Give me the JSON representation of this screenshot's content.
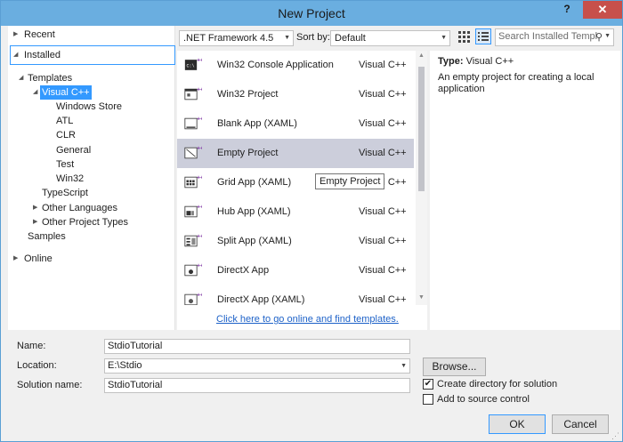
{
  "window": {
    "title": "New Project",
    "help_label": "?",
    "close_label": "✕"
  },
  "left_nav": {
    "recent": "Recent",
    "installed": "Installed",
    "templates": "Templates",
    "visual_cpp": "Visual C++",
    "vc_children": [
      "Windows Store",
      "ATL",
      "CLR",
      "General",
      "Test",
      "Win32"
    ],
    "typescript": "TypeScript",
    "other_languages": "Other Languages",
    "other_project_types": "Other Project Types",
    "samples": "Samples",
    "online": "Online"
  },
  "toolbar": {
    "framework": ".NET Framework 4.5",
    "sort_by_label": "Sort by:",
    "sort_by_value": "Default",
    "search_placeholder": "Search Installed Templ"
  },
  "templates": [
    {
      "name": "Win32 Console Application",
      "lang": "Visual C++",
      "icon": "console-app-icon"
    },
    {
      "name": "Win32 Project",
      "lang": "Visual C++",
      "icon": "win32-project-icon"
    },
    {
      "name": "Blank App (XAML)",
      "lang": "Visual C++",
      "icon": "blank-app-icon"
    },
    {
      "name": "Empty Project",
      "lang": "Visual C++",
      "icon": "empty-project-icon",
      "selected": true
    },
    {
      "name": "Grid App (XAML)",
      "lang": "Visual C++",
      "icon": "grid-app-icon"
    },
    {
      "name": "Hub App (XAML)",
      "lang": "Visual C++",
      "icon": "hub-app-icon"
    },
    {
      "name": "Split App (XAML)",
      "lang": "Visual C++",
      "icon": "split-app-icon"
    },
    {
      "name": "DirectX App",
      "lang": "Visual C++",
      "icon": "directx-app-icon"
    },
    {
      "name": "DirectX App (XAML)",
      "lang": "Visual C++",
      "icon": "directx-xaml-app-icon"
    }
  ],
  "tooltip": "Empty Project",
  "online_link": "Click here to go online and find templates.",
  "details": {
    "type_label": "Type:",
    "type_value": "Visual C++",
    "description": "An empty project for creating a local application"
  },
  "form": {
    "name_label": "Name:",
    "name_value": "StdioTutorial",
    "location_label": "Location:",
    "location_value": "E:\\Stdio",
    "solution_label": "Solution name:",
    "solution_value": "StdioTutorial",
    "browse_label": "Browse...",
    "create_dir_label": "Create directory for solution",
    "create_dir_checked": true,
    "source_control_label": "Add to source control",
    "source_control_checked": false,
    "ok_label": "OK",
    "cancel_label": "Cancel"
  },
  "colors": {
    "titlebar": "#6aaee0",
    "selection": "#3399ff",
    "selected_row": "#cccedb",
    "close_button": "#c7504b",
    "link": "#1e62c8"
  }
}
